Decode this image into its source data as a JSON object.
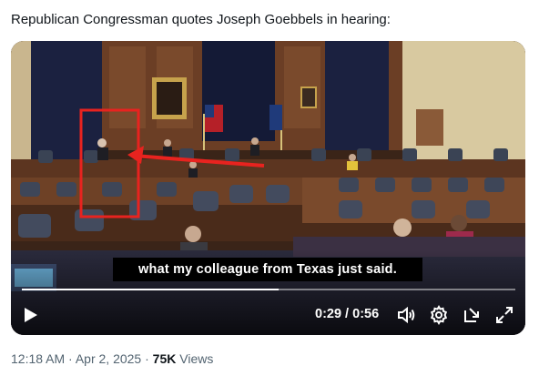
{
  "post": {
    "text": "Republican Congressman quotes Joseph Goebbels in hearing:"
  },
  "video": {
    "caption": "what my colleague from Texas just said.",
    "current_time": "0:29",
    "time_separator": " / ",
    "duration": "0:56",
    "progress_fraction": 0.52,
    "icons": [
      "play-icon",
      "volume-icon",
      "settings-gear-icon",
      "picture-in-picture-icon",
      "fullscreen-icon"
    ]
  },
  "meta": {
    "time": "12:18 AM",
    "separator1": " · ",
    "date": "Apr 2, 2025",
    "separator2": " · ",
    "views_count": "75K",
    "views_label": " Views"
  },
  "colors": {
    "highlight_box": "#e8231f",
    "arrow": "#e8231f",
    "text_primary": "#0f1419",
    "text_secondary": "#536471"
  }
}
